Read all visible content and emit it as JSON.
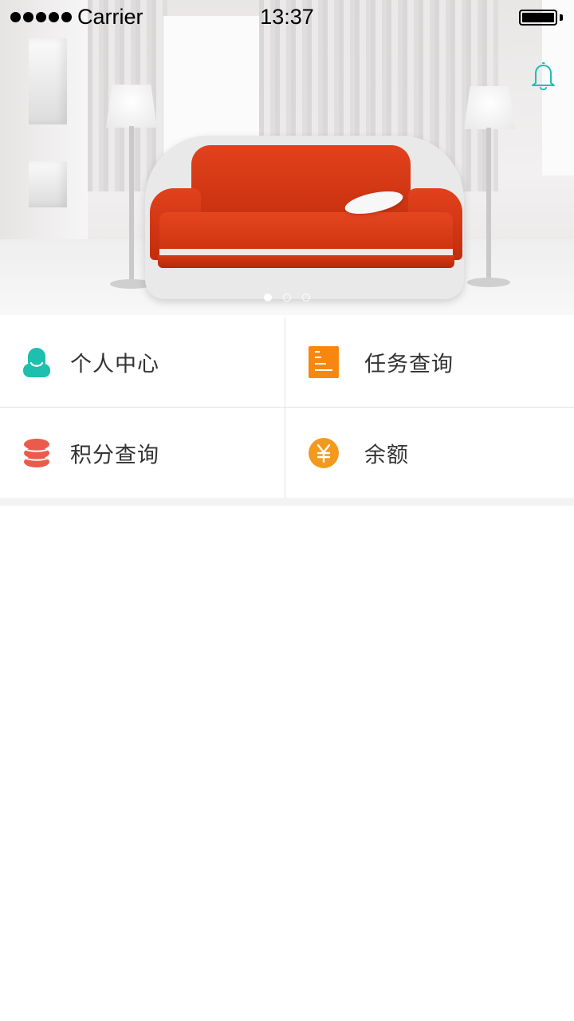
{
  "status_bar": {
    "carrier": "Carrier",
    "time": "13:37"
  },
  "banner": {
    "slide_count": 3,
    "active_slide": 1
  },
  "menu": {
    "items": [
      {
        "label": "个人中心",
        "icon": "person-icon",
        "color": "#1ebfae"
      },
      {
        "label": "任务查询",
        "icon": "document-icon",
        "color": "#f7870f"
      },
      {
        "label": "积分查询",
        "icon": "coins-stack-icon",
        "color": "#ec5a4c"
      },
      {
        "label": "余额",
        "icon": "yuan-coin-icon",
        "color": "#f39a1e"
      }
    ]
  },
  "colors": {
    "accent_teal": "#1ebfae",
    "background": "#ffffff",
    "divider": "#e3e3e3"
  }
}
